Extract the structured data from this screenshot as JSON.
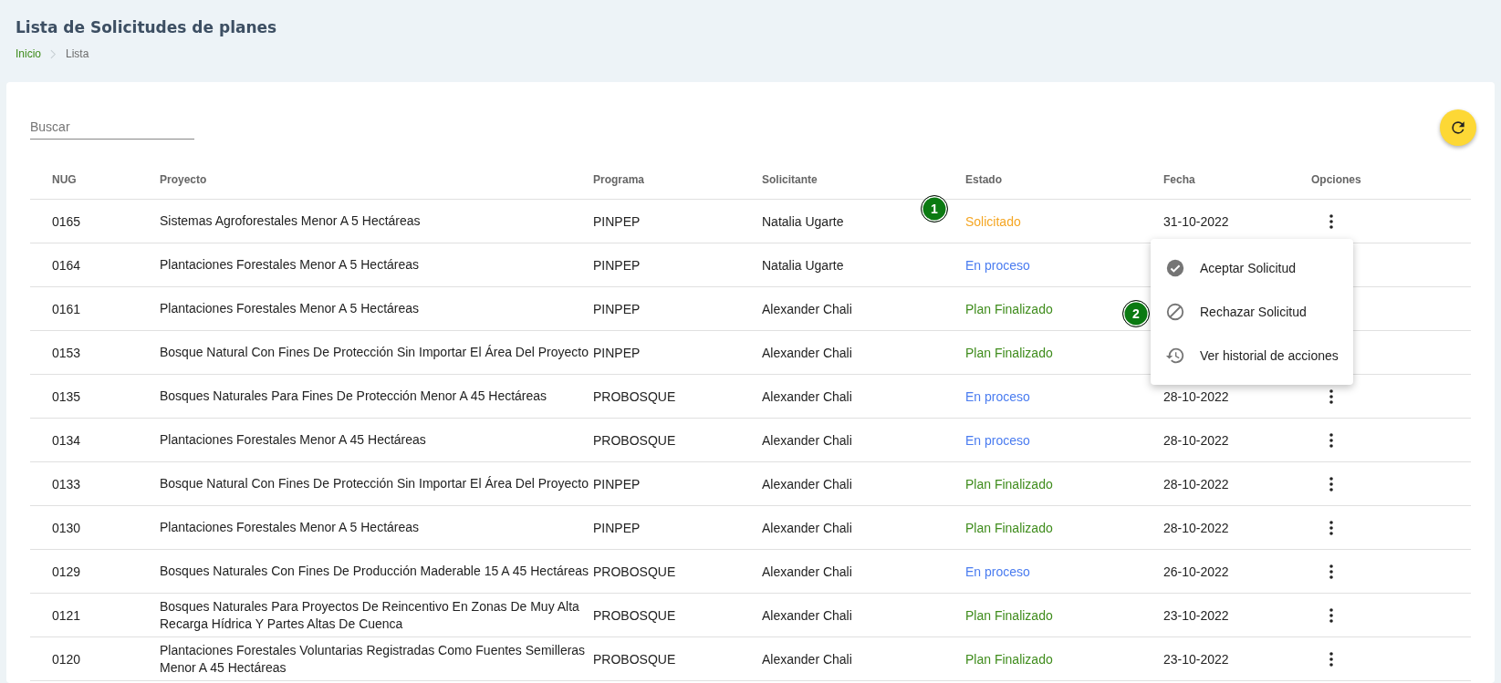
{
  "page": {
    "title": "Lista de Solicitudes de planes",
    "breadcrumb": [
      {
        "label": "Inicio",
        "kind": "link"
      },
      {
        "label": "Lista",
        "kind": "current"
      }
    ]
  },
  "search": {
    "placeholder": "Buscar"
  },
  "table": {
    "columns": [
      "NUG",
      "Proyecto",
      "Programa",
      "Solicitante",
      "Estado",
      "Fecha",
      "Opciones"
    ],
    "rows": [
      {
        "nug": "0165",
        "proyecto": "Sistemas Agroforestales Menor A 5 Hectáreas",
        "programa": "PINPEP",
        "solicitante": "Natalia Ugarte",
        "estado": "Solicitado",
        "color": "#f5a623",
        "fecha": "31-10-2022"
      },
      {
        "nug": "0164",
        "proyecto": "Plantaciones Forestales Menor A 5 Hectáreas",
        "programa": "PINPEP",
        "solicitante": "Natalia Ugarte",
        "estado": "En proceso",
        "color": "#4a7cf0"
      },
      {
        "nug": "0161",
        "proyecto": "Plantaciones Forestales Menor A 5 Hectáreas",
        "programa": "PINPEP",
        "solicitante": "Alexander Chali",
        "estado": "Plan Finalizado",
        "color": "#3f8c1c"
      },
      {
        "nug": "0153",
        "proyecto": "Bosque Natural Con Fines De Protección Sin Importar El Área Del Proyecto",
        "programa": "PINPEP",
        "solicitante": "Alexander Chali",
        "estado": "Plan Finalizado",
        "color": "#3f8c1c"
      },
      {
        "nug": "0135",
        "proyecto": "Bosques Naturales Para Fines De Protección Menor A 45 Hectáreas",
        "programa": "PROBOSQUE",
        "solicitante": "Alexander Chali",
        "estado": "En proceso",
        "color": "#4a7cf0",
        "fecha": "28-10-2022"
      },
      {
        "nug": "0134",
        "proyecto": "Plantaciones Forestales Menor A 45 Hectáreas",
        "programa": "PROBOSQUE",
        "solicitante": "Alexander Chali",
        "estado": "En proceso",
        "color": "#4a7cf0",
        "fecha": "28-10-2022"
      },
      {
        "nug": "0133",
        "proyecto": "Bosque Natural Con Fines De Protección Sin Importar El Área Del Proyecto",
        "programa": "PINPEP",
        "solicitante": "Alexander Chali",
        "estado": "Plan Finalizado",
        "color": "#3f8c1c",
        "fecha": "28-10-2022"
      },
      {
        "nug": "0130",
        "proyecto": "Plantaciones Forestales Menor A 5 Hectáreas",
        "programa": "PINPEP",
        "solicitante": "Alexander Chali",
        "estado": "Plan Finalizado",
        "color": "#3f8c1c",
        "fecha": "28-10-2022"
      },
      {
        "nug": "0129",
        "proyecto": "Bosques Naturales Con Fines De Producción Maderable 15 A 45 Hectáreas",
        "programa": "PROBOSQUE",
        "solicitante": "Alexander Chali",
        "estado": "En proceso",
        "color": "#4a7cf0",
        "fecha": "26-10-2022"
      },
      {
        "nug": "0121",
        "proyecto": "Bosques Naturales Para Proyectos De Reincentivo En Zonas De Muy Alta Recarga Hídrica Y Partes Altas De Cuenca",
        "programa": "PROBOSQUE",
        "solicitante": "Alexander Chali",
        "estado": "Plan Finalizado",
        "color": "#3f8c1c",
        "fecha": "23-10-2022"
      },
      {
        "nug": "0120",
        "proyecto": "Plantaciones Forestales Voluntarias Registradas Como Fuentes Semilleras Menor A 45 Hectáreas",
        "programa": "PROBOSQUE",
        "solicitante": "Alexander Chali",
        "estado": "Plan Finalizado",
        "color": "#3f8c1c",
        "fecha": "23-10-2022"
      }
    ]
  },
  "menu": {
    "items": [
      {
        "label": "Aceptar Solicitud",
        "kind": "accept"
      },
      {
        "label": "Rechazar Solicitud",
        "kind": "reject"
      },
      {
        "label": "Ver historial de acciones",
        "kind": "history"
      }
    ]
  },
  "markers": [
    {
      "label": "1"
    },
    {
      "label": "2"
    }
  ]
}
